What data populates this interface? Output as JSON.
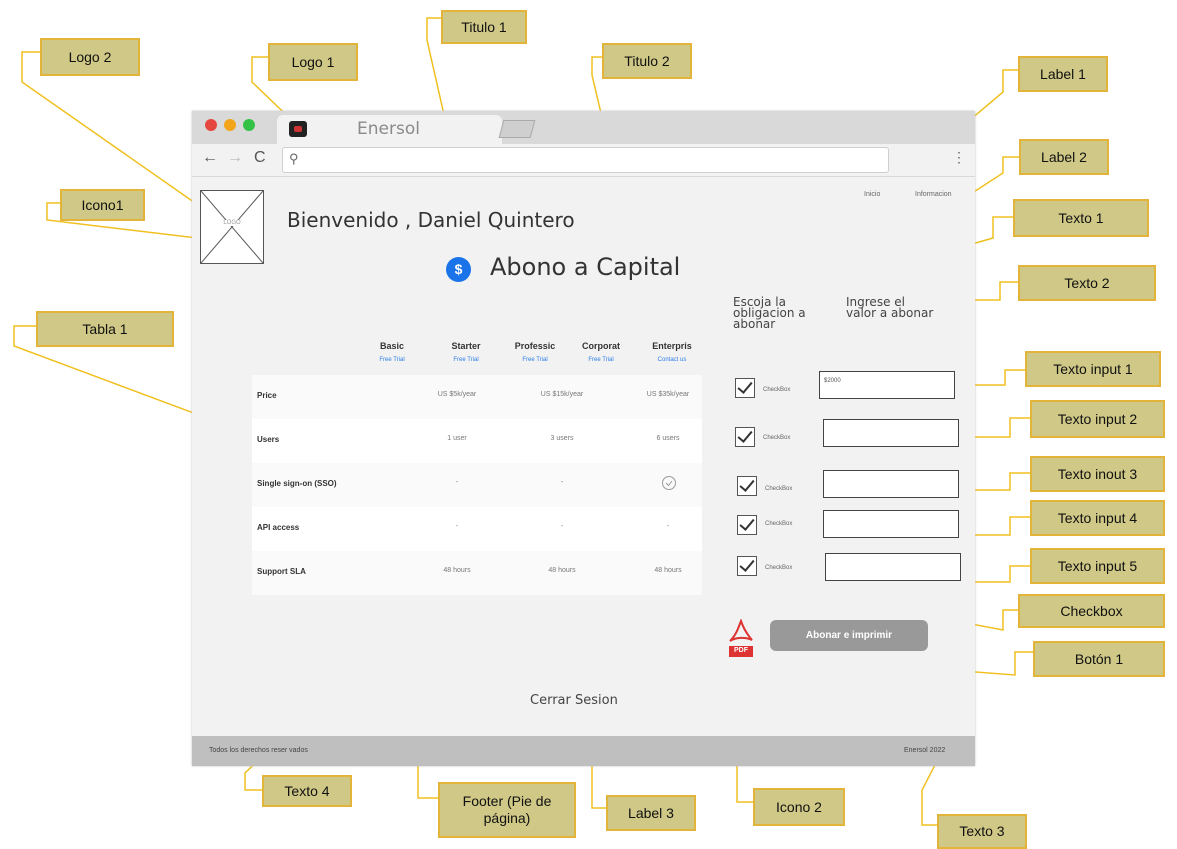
{
  "callouts": {
    "logo2": "Logo 2",
    "logo1": "Logo 1",
    "titulo1": "Titulo 1",
    "titulo2": "Titulo 2",
    "label1": "Label 1",
    "label2": "Label 2",
    "icono1": "Icono1",
    "texto1": "Texto 1",
    "texto2": "Texto 2",
    "tabla1": "Tabla 1",
    "texto_input_1": "Texto input 1",
    "texto_input_2": "Texto input 2",
    "texto_input_3": "Texto inout 3",
    "texto_input_4": "Texto input 4",
    "texto_input_5": "Texto input 5",
    "checkbox": "Checkbox",
    "boton1": "Botón 1",
    "texto4": "Texto 4",
    "footer": "Footer (Pie de página)",
    "label3": "Label 3",
    "icono2": "Icono 2",
    "texto3": "Texto 3"
  },
  "browser": {
    "tab_title": "Enersol",
    "url_icon": "search-icon"
  },
  "page": {
    "logo_text": "LOGO",
    "nav": [
      "Inicio",
      "Informacion"
    ],
    "welcome": "Bienvenido ,  Daniel Quintero",
    "capital_icon": "$",
    "capital_title": "Abono a Capital",
    "col1_header": [
      "Escoja la",
      "obligacion  a",
      "abonar"
    ],
    "col2_header": [
      "Ingrese el",
      "valor a abonar"
    ],
    "checkbox_label": "CheckBox",
    "input1_value": "$2000",
    "button_label": "Abonar  e imprimir",
    "pdf_label": "PDF",
    "logout": "Cerrar Sesion",
    "footer_left": "Todos los derechos reser vados",
    "footer_right": "Enersol 2022"
  },
  "table": {
    "plans": [
      {
        "name": "Basic",
        "link": "Free Trial"
      },
      {
        "name": "Starter",
        "link": "Free Trial"
      },
      {
        "name": "Professic",
        "link": "Free Trial"
      },
      {
        "name": "Corporat",
        "link": "Free Trial"
      },
      {
        "name": "Enterpris",
        "link": "Contact us"
      }
    ],
    "rows": [
      {
        "label": "Price",
        "cells": [
          "US $5k/year",
          "US $15k/year",
          "US $35k/year"
        ]
      },
      {
        "label": "Users",
        "cells": [
          "1 user",
          "3 users",
          "6 users"
        ]
      },
      {
        "label": "Single sign-on (SSO)",
        "cells": [
          "-",
          "-",
          ""
        ]
      },
      {
        "label": "API access",
        "cells": [
          "-",
          "-",
          "-"
        ]
      },
      {
        "label": "Support SLA",
        "cells": [
          "48 hours",
          "48 hours",
          "48 hours"
        ]
      }
    ]
  },
  "colors": {
    "callout_fill": "#cfc886",
    "callout_border": "#e2b53a",
    "leader_line": "#f0c020",
    "accent_blue": "#1a73e8",
    "button_gray": "#999999"
  }
}
